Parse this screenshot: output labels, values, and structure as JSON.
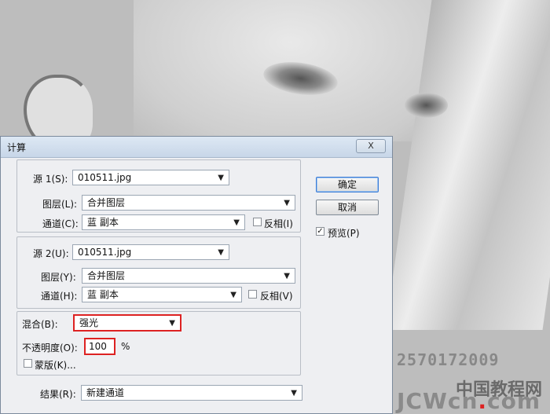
{
  "dialog": {
    "title": "计算",
    "close_label": "X",
    "source1": {
      "label": "源 1(S):",
      "file": "010511.jpg",
      "layer_label": "图层(L):",
      "layer_value": "合并图层",
      "channel_label": "通道(C):",
      "channel_value": "蓝 副本",
      "invert_label": "反相(I)",
      "invert_checked": false
    },
    "source2": {
      "label": "源 2(U):",
      "file": "010511.jpg",
      "layer_label": "图层(Y):",
      "layer_value": "合并图层",
      "channel_label": "通道(H):",
      "channel_value": "蓝 副本",
      "invert_label": "反相(V)",
      "invert_checked": false
    },
    "blending": {
      "label": "混合(B):",
      "value": "强光",
      "opacity_label": "不透明度(O):",
      "opacity_value": "100",
      "opacity_unit": "%",
      "mask_label": "蒙版(K)...",
      "mask_checked": false
    },
    "result": {
      "label": "结果(R):",
      "value": "新建通道"
    },
    "buttons": {
      "ok": "确定",
      "cancel": "取消",
      "preview_label": "预览(P)",
      "preview_checked": true
    }
  },
  "watermark": {
    "number": "2570172009",
    "site": "中国教程网",
    "brand_prefix": "JCWcn",
    "brand_dot": ".",
    "brand_suffix": "com"
  }
}
